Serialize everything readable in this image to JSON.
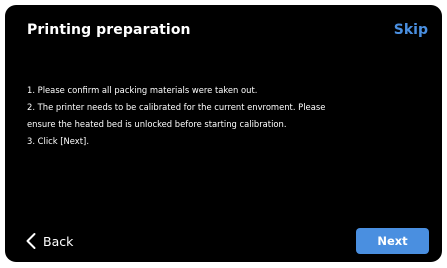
{
  "header": {
    "title": "Printing preparation",
    "skip_label": "Skip"
  },
  "instructions": [
    "1. Please confirm all packing materials were taken out.",
    "2. The printer needs to be calibrated for the current envroment. Please",
    "ensure the heated bed is unlocked before starting calibration.",
    "3. Click [Next]."
  ],
  "footer": {
    "back_icon": "chevron-left-icon",
    "back_label": "Back",
    "next_label": "Next"
  },
  "colors": {
    "background": "#000000",
    "accent": "#4a8fe0",
    "text": "#ffffff"
  }
}
